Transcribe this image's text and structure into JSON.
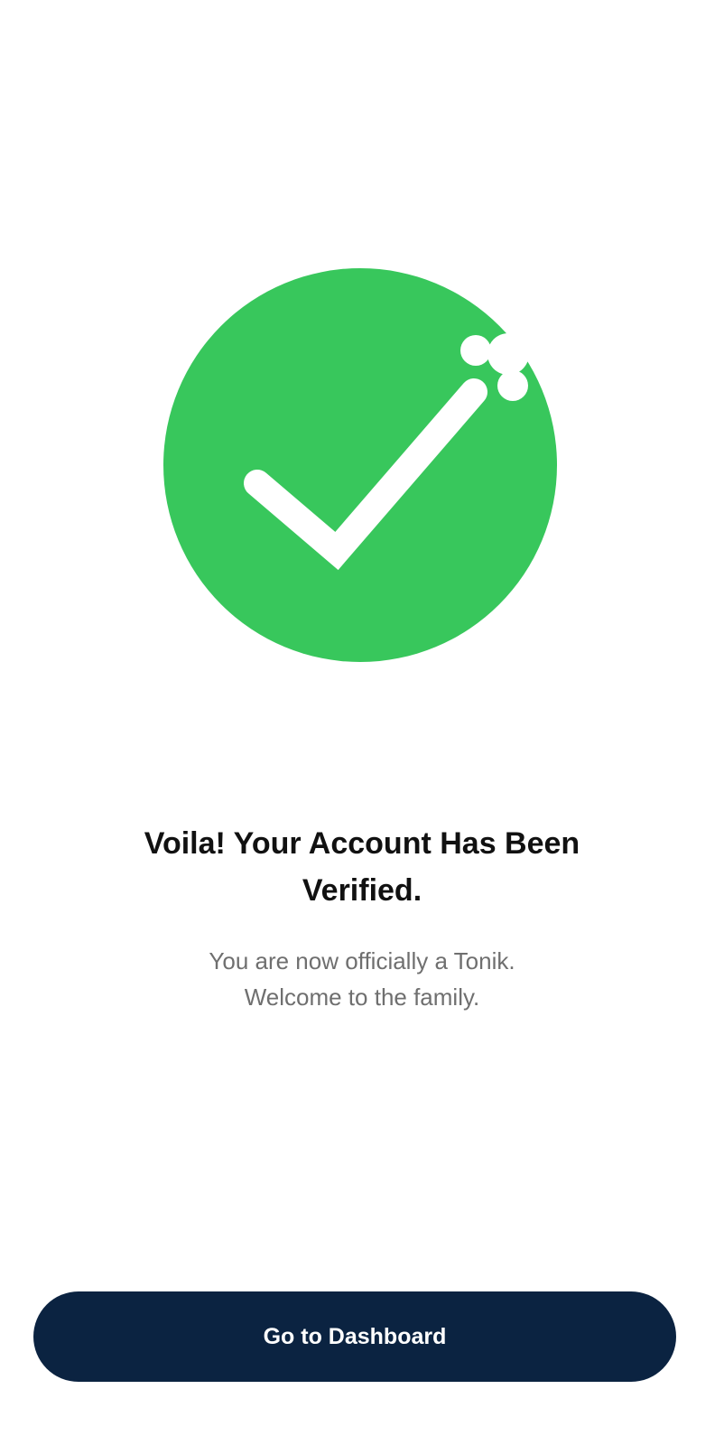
{
  "illustration": {
    "icon": "check-circle-icon",
    "circle_color": "#38c75c",
    "check_color": "#ffffff"
  },
  "headline": {
    "line1": "Voila! Your Account Has Been",
    "line2": "Verified."
  },
  "subtitle": {
    "line1": "You are now officially a Tonik.",
    "line2": "Welcome to the family."
  },
  "primary_action": {
    "label": "Go to Dashboard",
    "color": "#0b2341"
  }
}
